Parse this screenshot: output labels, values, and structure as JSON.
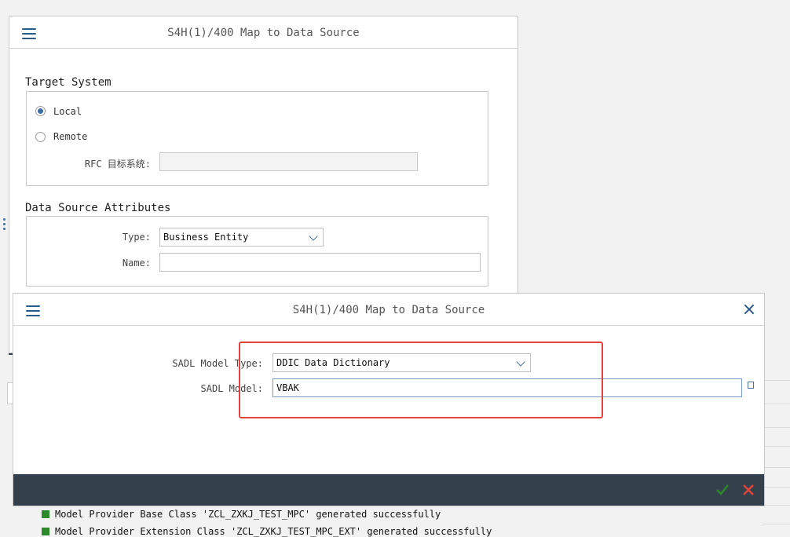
{
  "map_dialog": {
    "title": "S4H(1)/400 Map to Data Source",
    "target_system": {
      "title": "Target System",
      "local_label": "Local",
      "remote_label": "Remote",
      "selected": "Local",
      "rfc_label": "RFC 目标系统:",
      "rfc_value": ""
    },
    "attributes": {
      "title": "Data Source Attributes",
      "type_label": "Type:",
      "type_value": "Business Entity",
      "name_label": "Name:",
      "name_value": ""
    }
  },
  "sadl_dialog": {
    "title": "S4H(1)/400 Map to Data Source",
    "model_type_label": "SADL Model Type:",
    "model_type_value": "DDIC Data Dictionary",
    "model_label": "SADL Model:",
    "model_value": "VBAK"
  },
  "icons": {
    "menu": "hamburger-menu-icon",
    "close": "close-icon",
    "ok": "checkmark-icon",
    "cancel": "cancel-x-icon",
    "status": "success-square-icon"
  },
  "colors": {
    "accent": "#2d5c88",
    "footer": "#34404b",
    "highlight": "#e0443c",
    "success": "#2c8a2c",
    "cancel": "#e0443c"
  },
  "log": [
    "Model Provider Base Class 'ZCL_ZXKJ_TEST_MPC' generated successfully",
    "Model Provider Extension Class 'ZCL_ZXKJ_TEST_MPC_EXT' generated successfully"
  ]
}
